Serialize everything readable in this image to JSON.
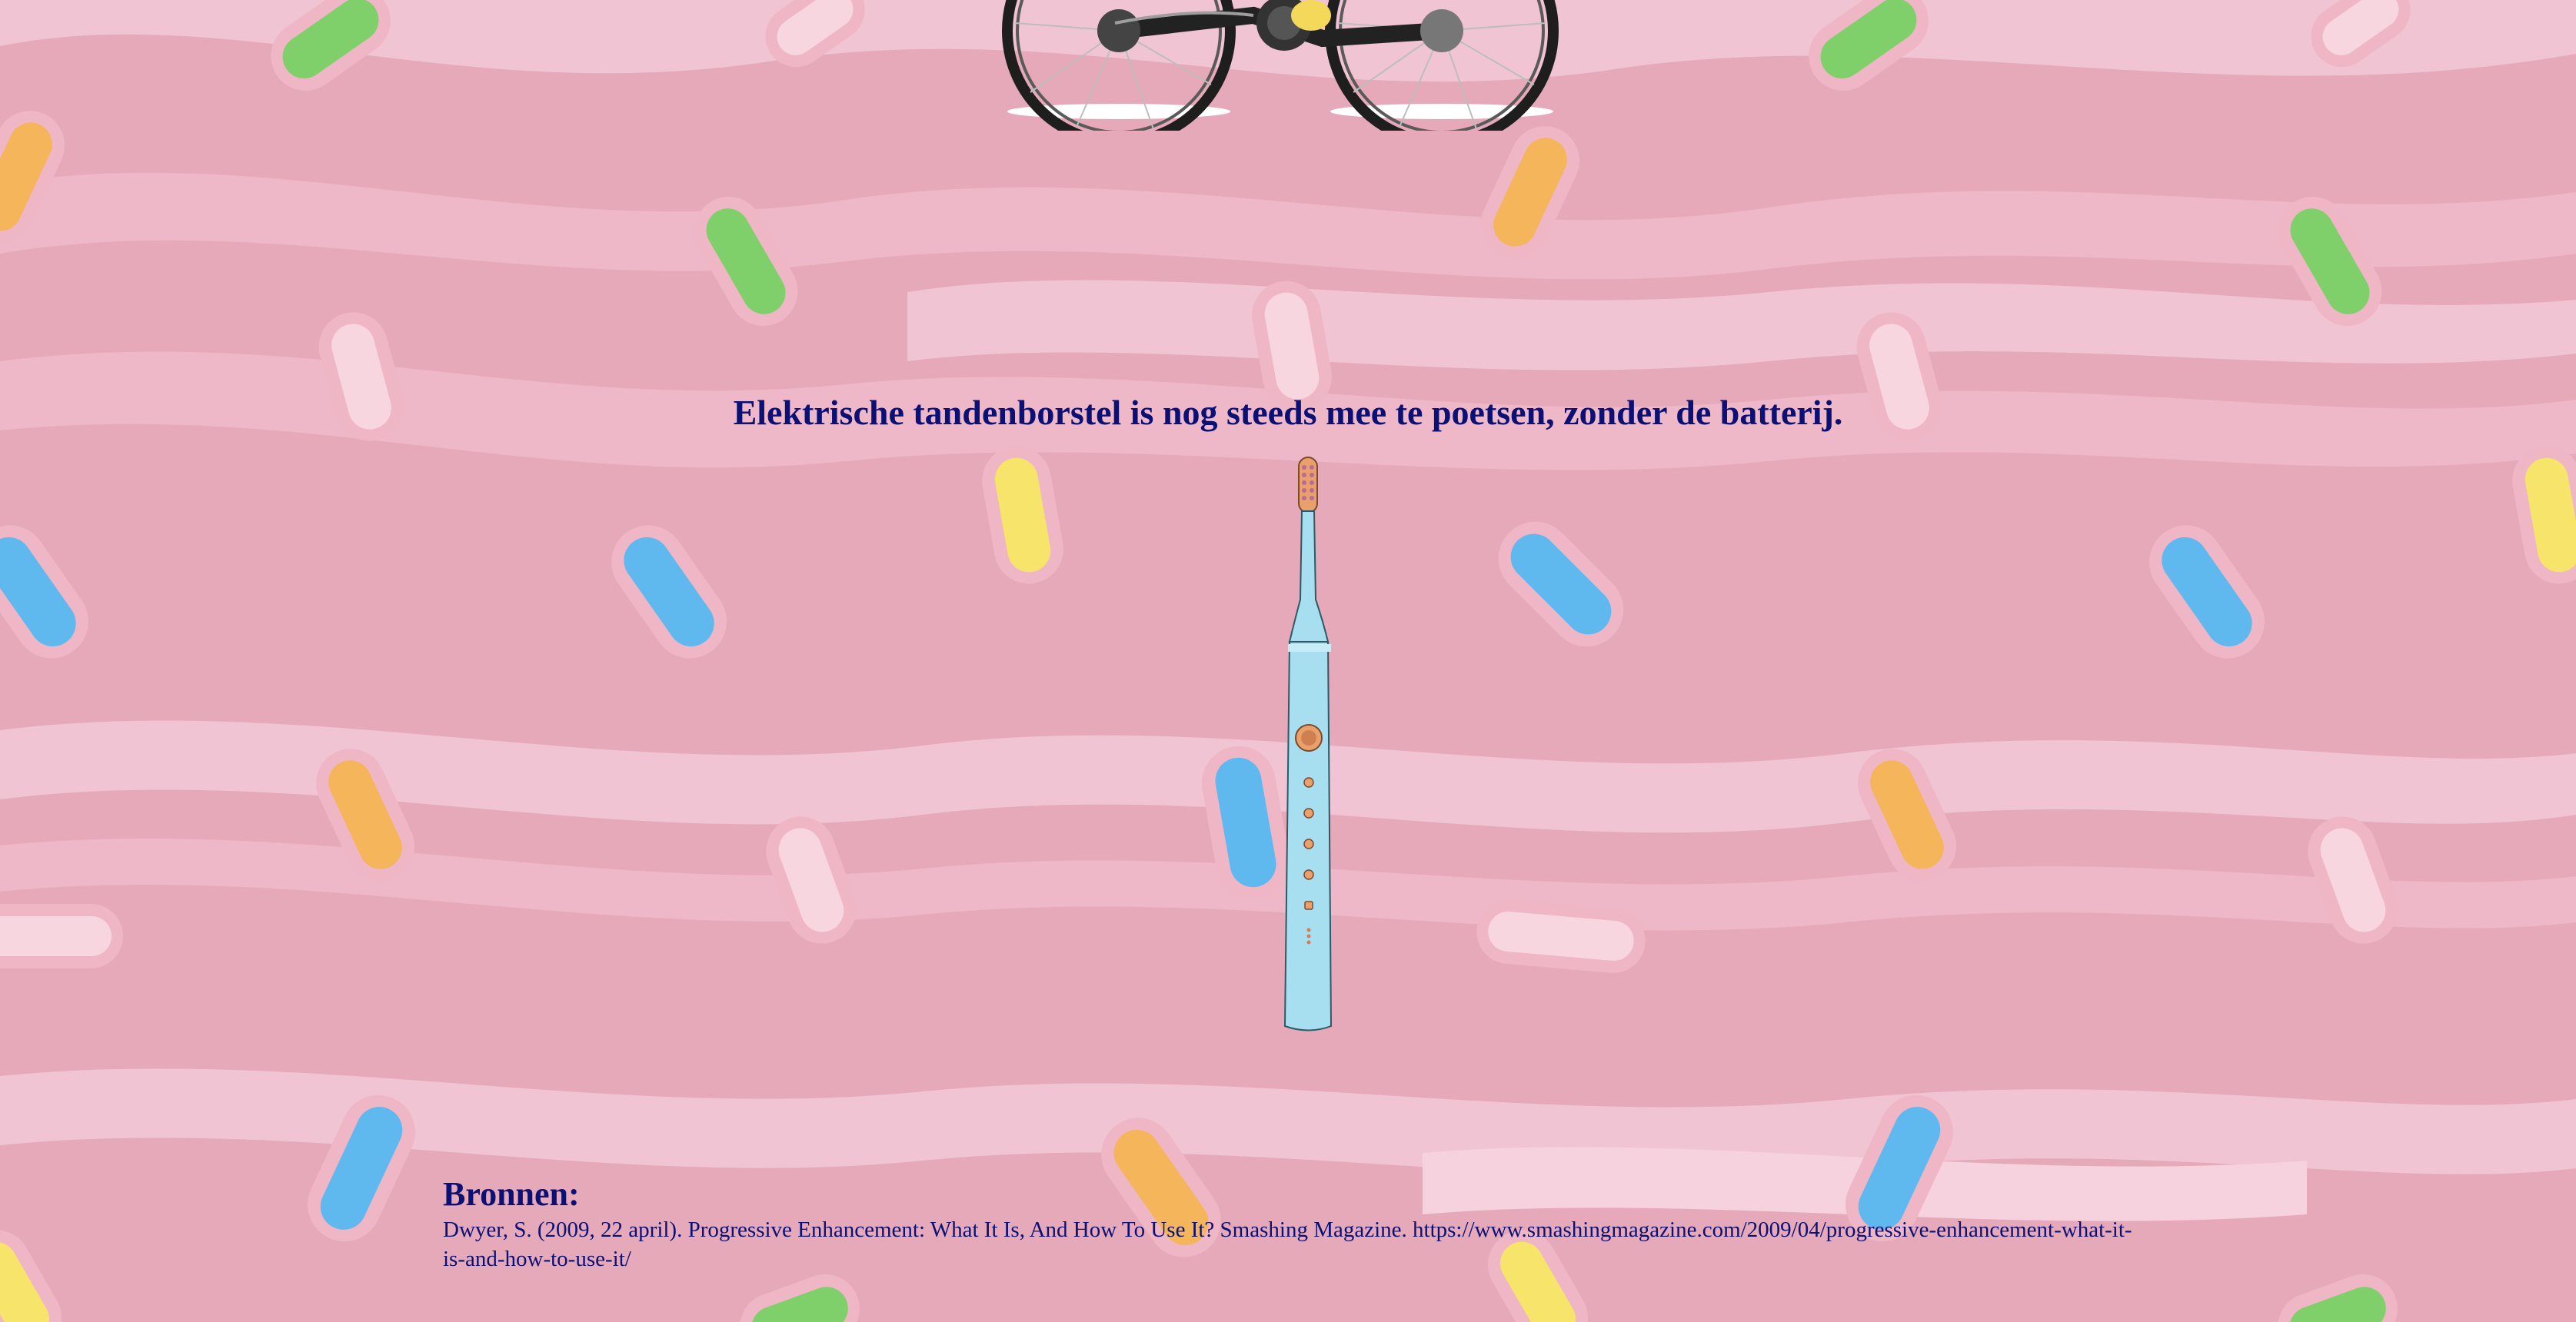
{
  "headline": "Elektrische tandenborstel is nog steeds mee te poetsen, zonder de batterij.",
  "sources": {
    "title": "Bronnen:",
    "citation": "Dwyer, S. (2009, 22 april). Progressive Enhancement: What It Is, And How To Use It? Smashing Magazine. https://www.smashingmagazine.com/2009/04/progressive-enhancement-what-it-is-and-how-to-use-it/"
  },
  "colors": {
    "background": "#e6a9b9",
    "background_wave": "#f0c4d3",
    "text": "#0b1075",
    "toothbrush_body": "#a8dff0",
    "toothbrush_accent": "#e0925a",
    "candy_green": "#7fcf6a",
    "candy_yellow": "#f7e46a",
    "candy_orange": "#f5b55a",
    "candy_blue": "#5fb8ee",
    "candy_pink": "#f7d6e0"
  },
  "icons": {
    "bike": "bicycle-illustration",
    "toothbrush": "electric-toothbrush-illustration",
    "pattern": "candy-sprinkles-pattern"
  }
}
